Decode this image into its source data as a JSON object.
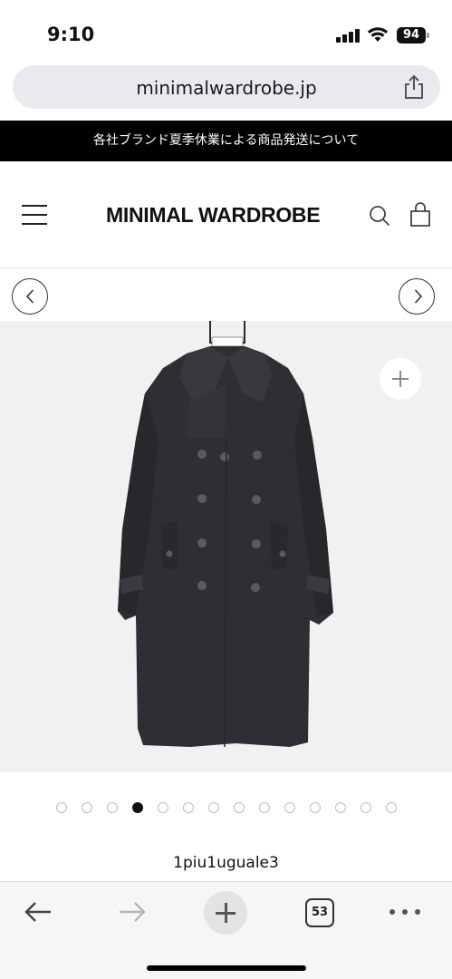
{
  "status_bar": {
    "time": "9:10",
    "battery": "94"
  },
  "browser": {
    "url": "minimalwardrobe.jp",
    "share_icon": "share-icon"
  },
  "announcement": {
    "text": "各社ブランド夏季休業による商品発送について"
  },
  "header": {
    "logo": "MINIMAL WARDROBE",
    "icons": [
      "menu-icon",
      "search-icon",
      "bag-icon"
    ]
  },
  "gallery": {
    "prev_icon": "chevron-left-icon",
    "next_icon": "chevron-right-icon",
    "zoom_icon": "plus-icon",
    "image_subject": "black double-breasted trench coat on hanger",
    "hanger_label": "1piu1uguale3",
    "total_images": 14,
    "active_index": 3
  },
  "product": {
    "brand": "1piu1uguale3"
  },
  "toolbar": {
    "tab_count": "53",
    "icons": [
      "back-arrow-icon",
      "forward-arrow-icon",
      "new-tab-icon",
      "tabs-icon",
      "more-icon"
    ]
  },
  "colors": {
    "announcement_bg": "#000000",
    "image_bg": "#f1f1f1",
    "coat": "#2e2e34",
    "url_bar_bg": "#e9eaee"
  }
}
